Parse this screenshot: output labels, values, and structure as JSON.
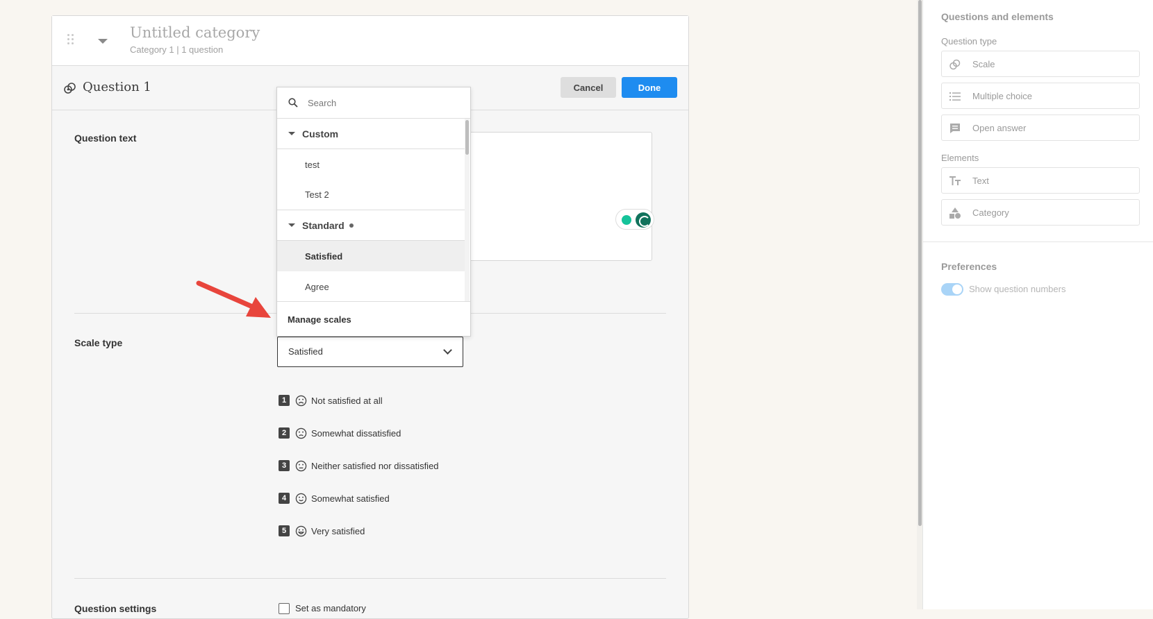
{
  "category": {
    "title": "Untitled category",
    "subtitle": "Category 1 | 1 question"
  },
  "question": {
    "title": "Question 1",
    "cancel_label": "Cancel",
    "done_label": "Done",
    "question_text_label": "Question text",
    "scale_type_label": "Scale type",
    "scale_type_value": "Satisfied",
    "settings_label": "Question settings",
    "mandatory_label": "Set as mandatory",
    "scale_items": [
      {
        "num": "1",
        "label": "Not satisfied at all",
        "face": "very-sad-face-icon"
      },
      {
        "num": "2",
        "label": "Somewhat dissatisfied",
        "face": "sad-face-icon"
      },
      {
        "num": "3",
        "label": "Neither satisfied nor dissatisfied",
        "face": "neutral-face-icon"
      },
      {
        "num": "4",
        "label": "Somewhat satisfied",
        "face": "smile-face-icon"
      },
      {
        "num": "5",
        "label": "Very satisfied",
        "face": "happy-face-icon"
      }
    ]
  },
  "dropdown": {
    "search_placeholder": "Search",
    "groups": [
      {
        "label": "Custom",
        "items": [
          "test",
          "Test 2"
        ]
      },
      {
        "label": "Standard",
        "items": [
          "Satisfied",
          "Agree"
        ]
      }
    ],
    "selected": "Satisfied",
    "manage_label": "Manage scales"
  },
  "panel": {
    "title": "Questions and elements",
    "question_type_label": "Question type",
    "question_types": [
      {
        "label": "Scale",
        "icon": "scale-icon"
      },
      {
        "label": "Multiple choice",
        "icon": "list-icon"
      },
      {
        "label": "Open answer",
        "icon": "chat-icon"
      }
    ],
    "elements_label": "Elements",
    "elements": [
      {
        "label": "Text",
        "icon": "text-icon"
      },
      {
        "label": "Category",
        "icon": "shapes-icon"
      }
    ],
    "preferences_label": "Preferences",
    "show_numbers_label": "Show question numbers"
  },
  "colors": {
    "accent": "#1e8cf0",
    "arrow": "#e8453c",
    "background": "#f9f6f1"
  }
}
